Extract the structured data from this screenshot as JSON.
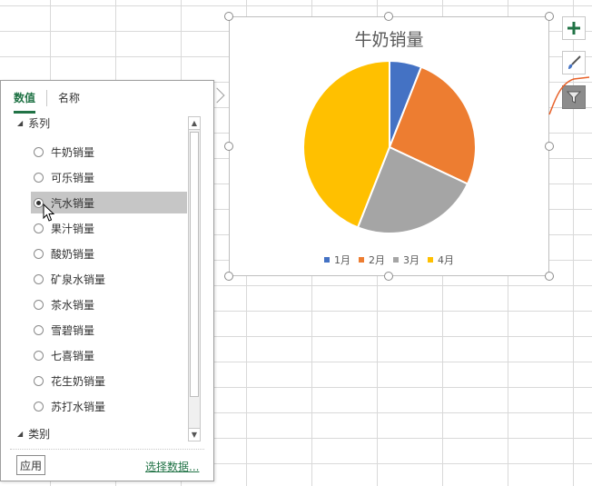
{
  "chart": {
    "title": "牛奶销量",
    "legend": [
      "1月",
      "2月",
      "3月",
      "4月"
    ],
    "colors": [
      "#4472c4",
      "#ed7d31",
      "#a5a5a5",
      "#ffc000"
    ]
  },
  "chart_data": {
    "type": "pie",
    "title": "牛奶销量",
    "categories": [
      "1月",
      "2月",
      "3月",
      "4月"
    ],
    "values": [
      6,
      26,
      24,
      44
    ],
    "colors": [
      "#4472c4",
      "#ed7d31",
      "#a5a5a5",
      "#ffc000"
    ]
  },
  "side_buttons": {
    "icons": [
      "plus-icon",
      "brush-icon",
      "funnel-icon"
    ]
  },
  "filter_pane": {
    "tabs": [
      "数值",
      "名称"
    ],
    "series_header": "系列",
    "series": [
      {
        "label": "牛奶销量",
        "checked": false
      },
      {
        "label": "可乐销量",
        "checked": false
      },
      {
        "label": "汽水销量",
        "checked": true
      },
      {
        "label": "果汁销量",
        "checked": false
      },
      {
        "label": "酸奶销量",
        "checked": false
      },
      {
        "label": "矿泉水销量",
        "checked": false
      },
      {
        "label": "茶水销量",
        "checked": false
      },
      {
        "label": "雪碧销量",
        "checked": false
      },
      {
        "label": "七喜销量",
        "checked": false
      },
      {
        "label": "花生奶销量",
        "checked": false
      },
      {
        "label": "苏打水销量",
        "checked": false
      }
    ],
    "category_header": "类别",
    "apply_label": "应用",
    "select_data_label": "选择数据..."
  }
}
